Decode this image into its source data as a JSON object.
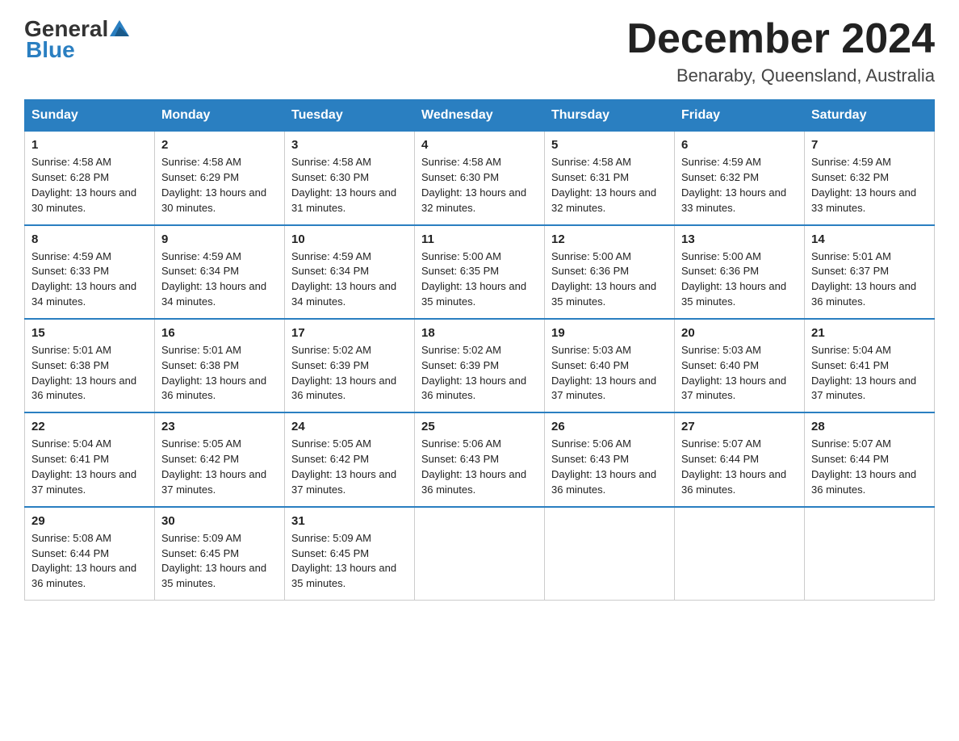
{
  "header": {
    "logo_general": "General",
    "logo_blue": "Blue",
    "month_title": "December 2024",
    "location": "Benaraby, Queensland, Australia"
  },
  "days_of_week": [
    "Sunday",
    "Monday",
    "Tuesday",
    "Wednesday",
    "Thursday",
    "Friday",
    "Saturday"
  ],
  "weeks": [
    [
      {
        "num": "1",
        "sunrise": "4:58 AM",
        "sunset": "6:28 PM",
        "daylight": "13 hours and 30 minutes."
      },
      {
        "num": "2",
        "sunrise": "4:58 AM",
        "sunset": "6:29 PM",
        "daylight": "13 hours and 30 minutes."
      },
      {
        "num": "3",
        "sunrise": "4:58 AM",
        "sunset": "6:30 PM",
        "daylight": "13 hours and 31 minutes."
      },
      {
        "num": "4",
        "sunrise": "4:58 AM",
        "sunset": "6:30 PM",
        "daylight": "13 hours and 32 minutes."
      },
      {
        "num": "5",
        "sunrise": "4:58 AM",
        "sunset": "6:31 PM",
        "daylight": "13 hours and 32 minutes."
      },
      {
        "num": "6",
        "sunrise": "4:59 AM",
        "sunset": "6:32 PM",
        "daylight": "13 hours and 33 minutes."
      },
      {
        "num": "7",
        "sunrise": "4:59 AM",
        "sunset": "6:32 PM",
        "daylight": "13 hours and 33 minutes."
      }
    ],
    [
      {
        "num": "8",
        "sunrise": "4:59 AM",
        "sunset": "6:33 PM",
        "daylight": "13 hours and 34 minutes."
      },
      {
        "num": "9",
        "sunrise": "4:59 AM",
        "sunset": "6:34 PM",
        "daylight": "13 hours and 34 minutes."
      },
      {
        "num": "10",
        "sunrise": "4:59 AM",
        "sunset": "6:34 PM",
        "daylight": "13 hours and 34 minutes."
      },
      {
        "num": "11",
        "sunrise": "5:00 AM",
        "sunset": "6:35 PM",
        "daylight": "13 hours and 35 minutes."
      },
      {
        "num": "12",
        "sunrise": "5:00 AM",
        "sunset": "6:36 PM",
        "daylight": "13 hours and 35 minutes."
      },
      {
        "num": "13",
        "sunrise": "5:00 AM",
        "sunset": "6:36 PM",
        "daylight": "13 hours and 35 minutes."
      },
      {
        "num": "14",
        "sunrise": "5:01 AM",
        "sunset": "6:37 PM",
        "daylight": "13 hours and 36 minutes."
      }
    ],
    [
      {
        "num": "15",
        "sunrise": "5:01 AM",
        "sunset": "6:38 PM",
        "daylight": "13 hours and 36 minutes."
      },
      {
        "num": "16",
        "sunrise": "5:01 AM",
        "sunset": "6:38 PM",
        "daylight": "13 hours and 36 minutes."
      },
      {
        "num": "17",
        "sunrise": "5:02 AM",
        "sunset": "6:39 PM",
        "daylight": "13 hours and 36 minutes."
      },
      {
        "num": "18",
        "sunrise": "5:02 AM",
        "sunset": "6:39 PM",
        "daylight": "13 hours and 36 minutes."
      },
      {
        "num": "19",
        "sunrise": "5:03 AM",
        "sunset": "6:40 PM",
        "daylight": "13 hours and 37 minutes."
      },
      {
        "num": "20",
        "sunrise": "5:03 AM",
        "sunset": "6:40 PM",
        "daylight": "13 hours and 37 minutes."
      },
      {
        "num": "21",
        "sunrise": "5:04 AM",
        "sunset": "6:41 PM",
        "daylight": "13 hours and 37 minutes."
      }
    ],
    [
      {
        "num": "22",
        "sunrise": "5:04 AM",
        "sunset": "6:41 PM",
        "daylight": "13 hours and 37 minutes."
      },
      {
        "num": "23",
        "sunrise": "5:05 AM",
        "sunset": "6:42 PM",
        "daylight": "13 hours and 37 minutes."
      },
      {
        "num": "24",
        "sunrise": "5:05 AM",
        "sunset": "6:42 PM",
        "daylight": "13 hours and 37 minutes."
      },
      {
        "num": "25",
        "sunrise": "5:06 AM",
        "sunset": "6:43 PM",
        "daylight": "13 hours and 36 minutes."
      },
      {
        "num": "26",
        "sunrise": "5:06 AM",
        "sunset": "6:43 PM",
        "daylight": "13 hours and 36 minutes."
      },
      {
        "num": "27",
        "sunrise": "5:07 AM",
        "sunset": "6:44 PM",
        "daylight": "13 hours and 36 minutes."
      },
      {
        "num": "28",
        "sunrise": "5:07 AM",
        "sunset": "6:44 PM",
        "daylight": "13 hours and 36 minutes."
      }
    ],
    [
      {
        "num": "29",
        "sunrise": "5:08 AM",
        "sunset": "6:44 PM",
        "daylight": "13 hours and 36 minutes."
      },
      {
        "num": "30",
        "sunrise": "5:09 AM",
        "sunset": "6:45 PM",
        "daylight": "13 hours and 35 minutes."
      },
      {
        "num": "31",
        "sunrise": "5:09 AM",
        "sunset": "6:45 PM",
        "daylight": "13 hours and 35 minutes."
      },
      null,
      null,
      null,
      null
    ]
  ]
}
